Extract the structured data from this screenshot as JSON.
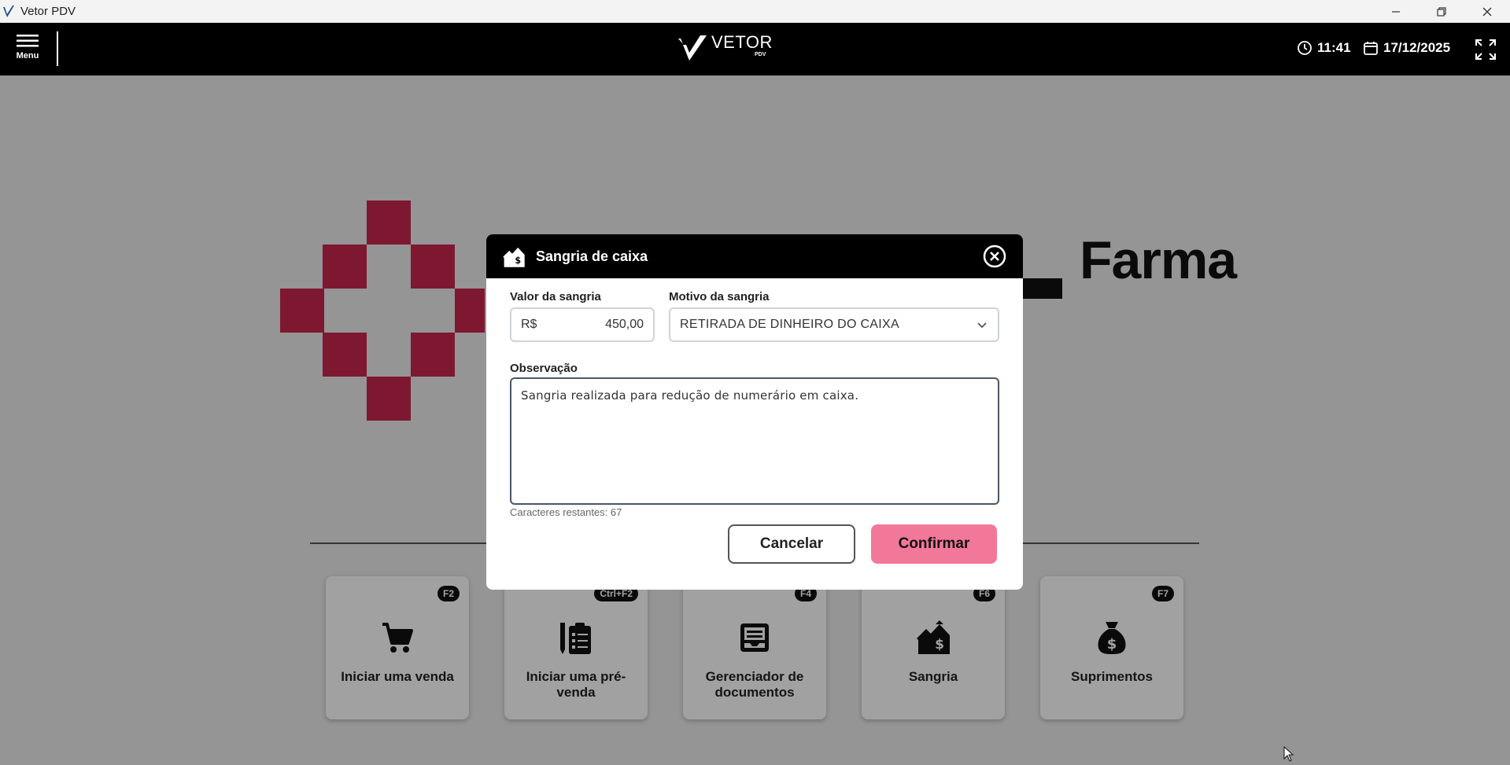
{
  "os_window": {
    "title": "Vetor PDV"
  },
  "header": {
    "menu_label": "Menu",
    "brand_name": "VETOR",
    "brand_sub": "PDV",
    "time": "11:41",
    "date": "17/12/2025"
  },
  "background": {
    "brand_word": "Farma",
    "brand_color": "#c8264e",
    "tiles": [
      {
        "shortcut": "F2",
        "label": "Iniciar uma venda",
        "icon": "cart-icon"
      },
      {
        "shortcut": "Ctrl+F2",
        "label": "Iniciar uma pré-venda",
        "icon": "clipboard-pencil-icon"
      },
      {
        "shortcut": "F4",
        "label": "Gerenciador de documentos",
        "icon": "document-tray-icon"
      },
      {
        "shortcut": "F6",
        "label": "Sangria",
        "icon": "house-money-icon"
      },
      {
        "shortcut": "F7",
        "label": "Suprimentos",
        "icon": "money-bag-icon"
      }
    ]
  },
  "modal": {
    "title": "Sangria de caixa",
    "amount_label": "Valor da sangria",
    "currency": "R$",
    "amount_value": "450,00",
    "reason_label": "Motivo da sangria",
    "reason_value": "RETIRADA DE DINHEIRO DO CAIXA",
    "note_label": "Observação",
    "note_value": "Sangria realizada para redução de numerário em caixa.",
    "chars_remaining": "Caracteres restantes: 67",
    "cancel_label": "Cancelar",
    "confirm_label": "Confirmar",
    "confirm_color": "#f2789a"
  }
}
